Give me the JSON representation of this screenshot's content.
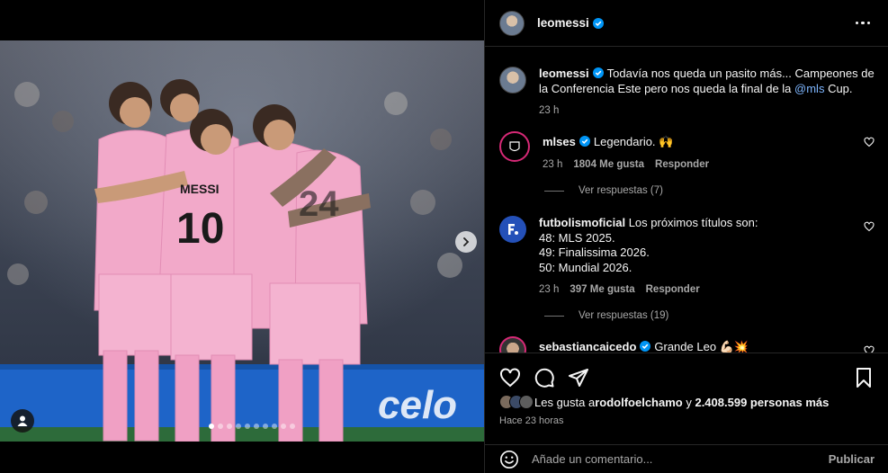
{
  "post": {
    "author": "leomessi",
    "caption_author": "leomessi",
    "caption_text": "Todavía nos queda un pasito más... Campeones de la Conferencia Este pero nos queda la final de la ",
    "caption_mention": "@mls",
    "caption_end": " Cup.",
    "caption_time": "23 h",
    "carousel": {
      "total": 10,
      "active_index": 0
    }
  },
  "comments": [
    {
      "user": "mlses",
      "text": "Legendario. 🙌",
      "time": "23 h",
      "likes": "1804 Me gusta",
      "reply": "Responder",
      "view_replies": "Ver respuestas (7)"
    },
    {
      "user": "futbolismoficial",
      "text_line1": "Los próximos títulos son:",
      "text_line2": "48: MLS 2025.",
      "text_line3": "49: Finalissima 2026.",
      "text_line4": "50: Mundial 2026.",
      "time": "23 h",
      "likes": "397 Me gusta",
      "reply": "Responder",
      "view_replies": "Ver respuestas (19)"
    },
    {
      "user": "sebastiancaicedo",
      "text": "Grande Leo 💪🏻💥"
    }
  ],
  "actions": {
    "likes_prefix": "Les gusta a ",
    "likes_user": "rodolfoelchamo",
    "likes_middle": " y ",
    "likes_count": "2.408.599 personas más",
    "time_ago": "Hace 23 horas"
  },
  "comment_box": {
    "placeholder": "Añade un comentario...",
    "publish": "Publicar"
  },
  "colors": {
    "background": "#000000",
    "verified": "#0095f6",
    "secondary_text": "#a8a8a8",
    "kit_pink": "#f2a9c9"
  },
  "icons": [
    "more-icon",
    "verified-icon",
    "heart-icon",
    "comment-icon",
    "share-icon",
    "bookmark-icon",
    "emoji-icon",
    "user-tag-icon",
    "chevron-right-icon"
  ]
}
